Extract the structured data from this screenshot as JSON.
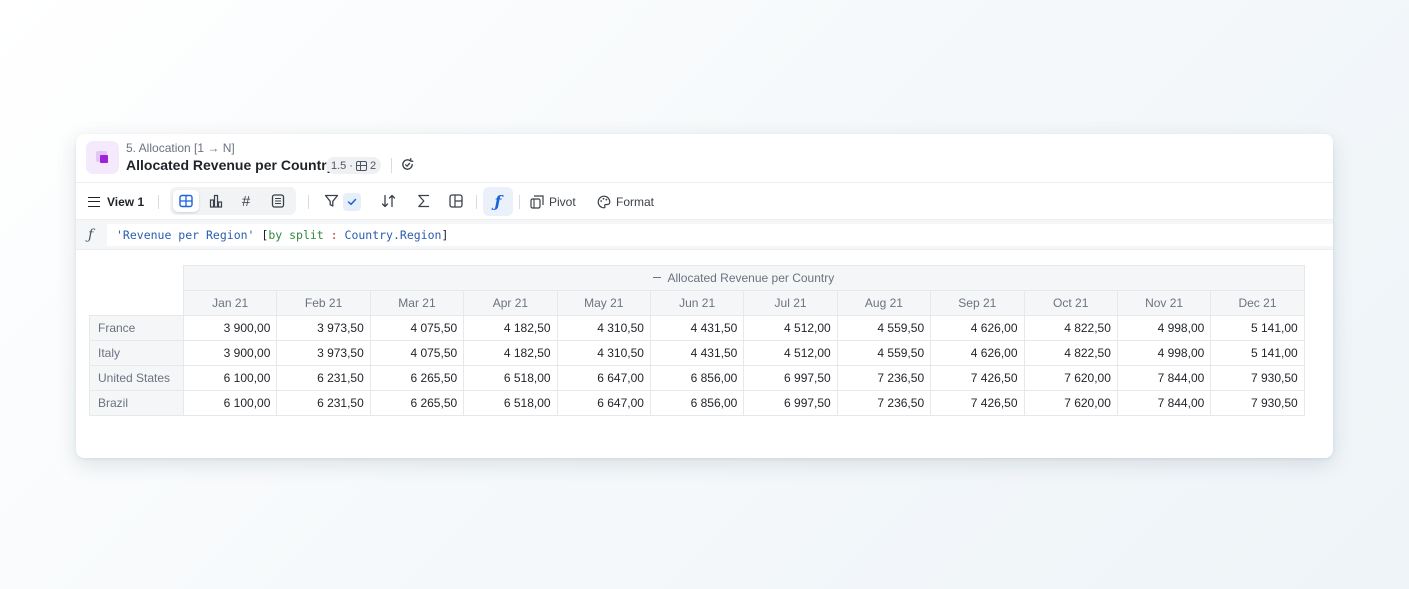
{
  "header": {
    "breadcrumb": "5. Allocation [1 → N]",
    "title": "Allocated Revenue per Country",
    "meta_version": "1.5",
    "meta_sep": "·",
    "meta_dims": "2"
  },
  "toolbar": {
    "view_label": "View 1",
    "pivot_label": "Pivot",
    "format_label": "Format"
  },
  "formula": {
    "part1": "'Revenue per Region'",
    "part2": " [",
    "part3": "by split",
    "part4": " : ",
    "part5": "Country.Region",
    "part6": "]"
  },
  "table": {
    "group_header": "Allocated Revenue per Country",
    "columns": [
      "Jan 21",
      "Feb 21",
      "Mar 21",
      "Apr 21",
      "May 21",
      "Jun 21",
      "Jul 21",
      "Aug 21",
      "Sep 21",
      "Oct 21",
      "Nov 21",
      "Dec 21"
    ],
    "rows": [
      {
        "label": "France",
        "values": [
          "3 900,00",
          "3 973,50",
          "4 075,50",
          "4 182,50",
          "4 310,50",
          "4 431,50",
          "4 512,00",
          "4 559,50",
          "4 626,00",
          "4 822,50",
          "4 998,00",
          "5 141,00"
        ]
      },
      {
        "label": "Italy",
        "values": [
          "3 900,00",
          "3 973,50",
          "4 075,50",
          "4 182,50",
          "4 310,50",
          "4 431,50",
          "4 512,00",
          "4 559,50",
          "4 626,00",
          "4 822,50",
          "4 998,00",
          "5 141,00"
        ]
      },
      {
        "label": "United States",
        "values": [
          "6 100,00",
          "6 231,50",
          "6 265,50",
          "6 518,00",
          "6 647,00",
          "6 856,00",
          "6 997,50",
          "7 236,50",
          "7 426,50",
          "7 620,00",
          "7 844,00",
          "7 930,50"
        ]
      },
      {
        "label": "Brazil",
        "values": [
          "6 100,00",
          "6 231,50",
          "6 265,50",
          "6 518,00",
          "6 647,00",
          "6 856,00",
          "6 997,50",
          "7 236,50",
          "7 426,50",
          "7 620,00",
          "7 844,00",
          "7 930,50"
        ]
      }
    ]
  },
  "colors": {
    "accent": "#1b64d8",
    "block_icon": "#a022d6"
  }
}
